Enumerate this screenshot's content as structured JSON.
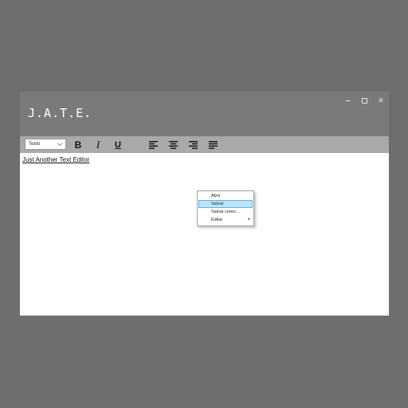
{
  "app": {
    "title": "J.A.T.E."
  },
  "window_controls": {
    "minimize": "minimize-icon",
    "maximize": "maximize-icon",
    "close": "✕"
  },
  "toolbar": {
    "style_select": {
      "value": "Texto"
    },
    "bold": "B",
    "italic": "I",
    "underline": "U",
    "align_icons": [
      "align-left-icon",
      "align-center-icon",
      "align-right-icon",
      "align-justify-icon"
    ]
  },
  "editor": {
    "content": "Just Another Text Editor"
  },
  "context_menu": {
    "items": [
      {
        "label": "Abrir"
      },
      {
        "label": "Salvar",
        "highlighted": true
      },
      {
        "label": "Salvar como..."
      },
      {
        "label": "Editar",
        "has_submenu": true
      }
    ]
  },
  "colors": {
    "background": "#6e6e6e",
    "titlebar": "#7a7a7a",
    "toolbar": "#a9a9a9",
    "menu_highlight": "#bde4f8"
  }
}
